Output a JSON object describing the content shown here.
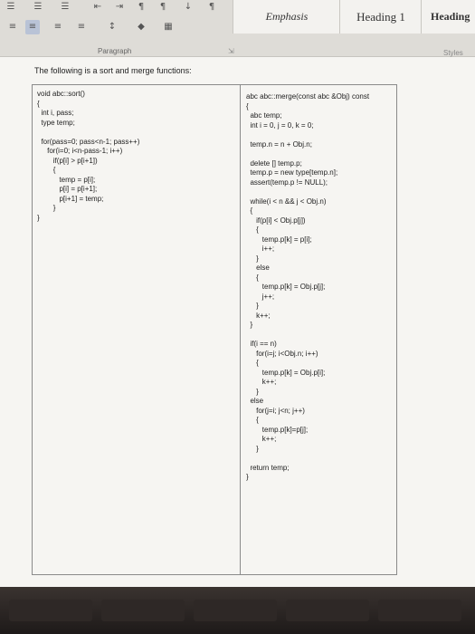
{
  "ribbon": {
    "styles": {
      "emphasis": "Emphasis",
      "heading1": "Heading 1",
      "heading": "Heading"
    },
    "paragraph_label": "Paragraph",
    "styles_label": "Styles"
  },
  "document": {
    "intro": "The following is a sort and merge functions:",
    "left_code": "void abc::sort()\n{\n  int i, pass;\n  type temp;\n\n  for(pass=0; pass<n-1; pass++)\n     for(i=0; i<n-pass-1; i++)\n        if(p[i] > p[i+1])\n        {\n           temp = p[i];\n           p[i] = p[i+1];\n           p[i+1] = temp;\n        }\n}",
    "right_code": "abc abc::merge(const abc &Obj) const\n{\n  abc temp;\n  int i = 0, j = 0, k = 0;\n\n  temp.n = n + Obj.n;\n\n  delete [] temp.p;\n  temp.p = new type[temp.n];\n  assert(temp.p != NULL);\n\n  while(i < n && j < Obj.n)\n  {\n     if(p[i] < Obj.p[j])\n     {\n        temp.p[k] = p[i];\n        i++;\n     }\n     else\n     {\n        temp.p[k] = Obj.p[j];\n        j++;\n     }\n     k++;\n  }\n\n  if(i == n)\n     for(i=j; i<Obj.n; i++)\n     {\n        temp.p[k] = Obj.p[i];\n        k++;\n     }\n  else\n     for(j=i; j<n; j++)\n     {\n        temp.p[k]=p[j];\n        k++;\n     }\n\n  return temp;\n}"
  }
}
